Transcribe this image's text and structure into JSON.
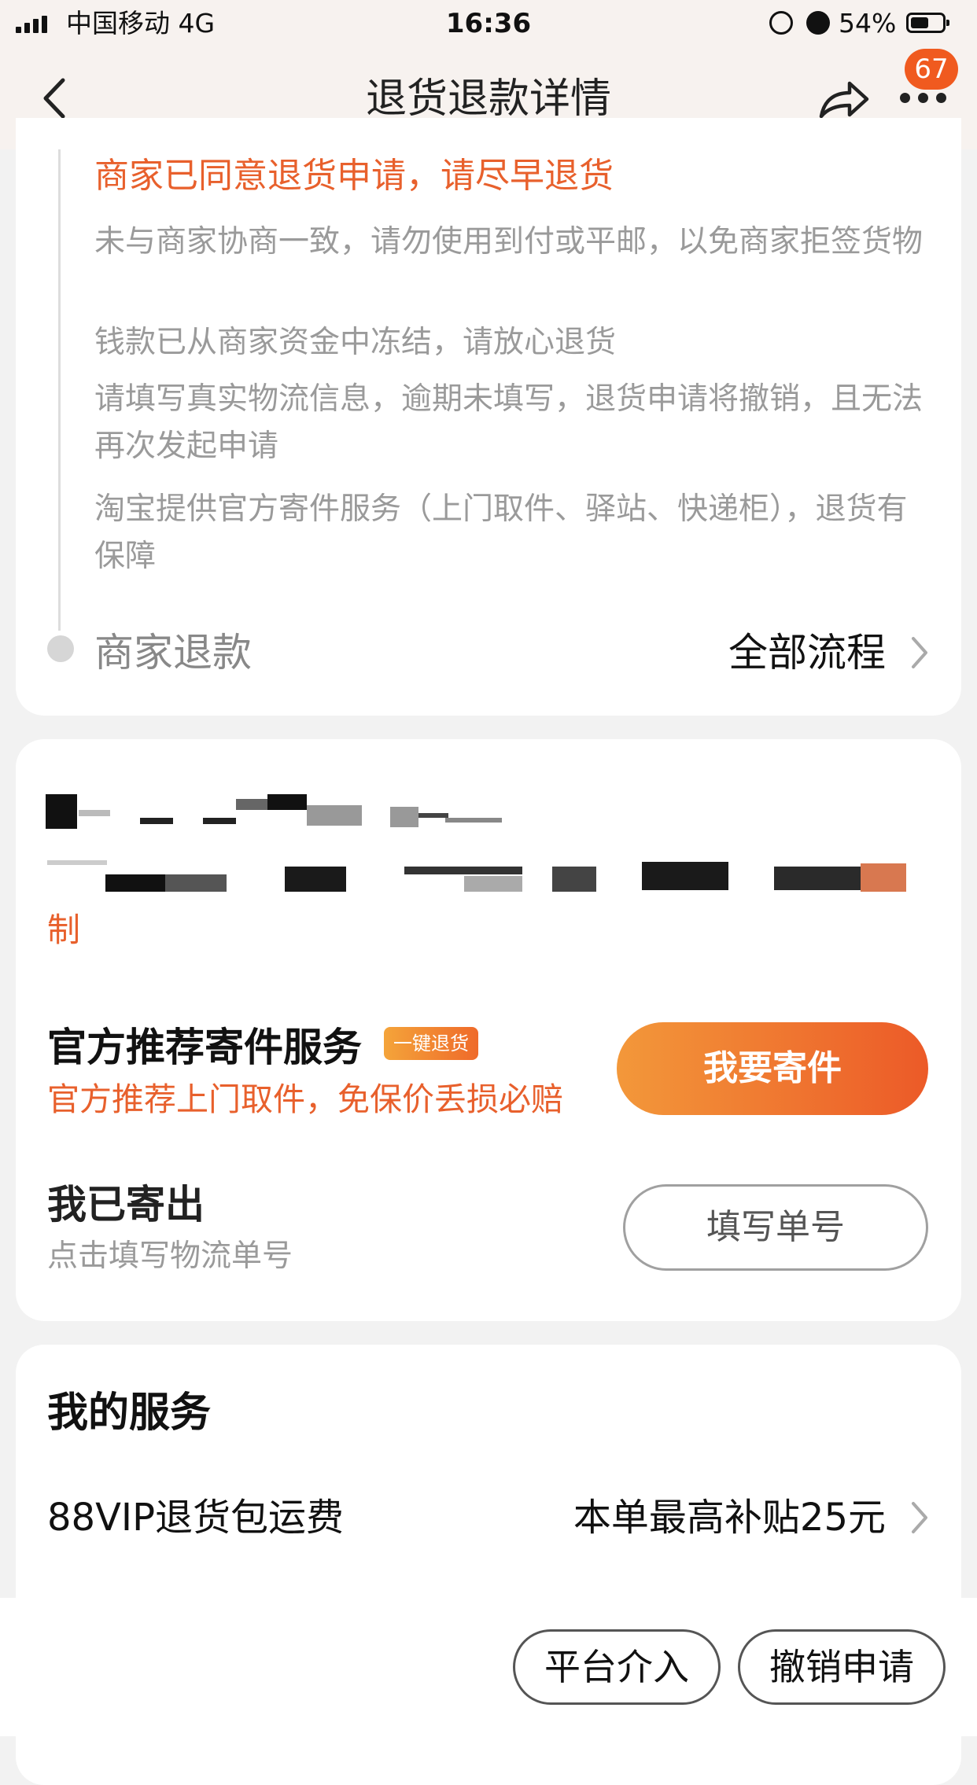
{
  "status_bar": {
    "carrier": "中国移动  4G",
    "time": "16:36",
    "battery": "54%"
  },
  "nav": {
    "title": "退货退款详情",
    "badge_count": "67",
    "icons": [
      "back-arrow-icon",
      "share-icon",
      "more-icon"
    ]
  },
  "progress": {
    "current_step_title": "商家已同意退货申请，请尽早退货",
    "notes": [
      "未与商家协商一致，请勿使用到付或平邮，以免商家拒签货物",
      "钱款已从商家资金中冻结，请放心退货",
      "请填写真实物流信息，逾期未填写，退货申请将撤销，且无法再次发起申请",
      "淘宝提供官方寄件服务（上门取件、驿站、快递柜），退货有保障"
    ],
    "next_step": "商家退款",
    "all_flow_link": "全部流程"
  },
  "return_card": {
    "partial_text": "制",
    "official_service": {
      "title": "官方推荐寄件服务",
      "tag": "一键退货",
      "subtitle": "官方推荐上门取件，免保价丢损必赔",
      "button": "我要寄件"
    },
    "shipped": {
      "title": "我已寄出",
      "subtitle": "点击填写物流单号",
      "button": "填写单号"
    }
  },
  "my_services": {
    "title": "我的服务",
    "row_label": "88VIP退货包运费",
    "row_value": "本单最高补贴25元"
  },
  "bottom_actions": {
    "platform": "平台介入",
    "cancel": "撤销申请"
  },
  "colors": {
    "accent": "#e8602c",
    "button_gradient_start": "#f3983a",
    "button_gradient_end": "#ec5a28",
    "badge": "#f05a1f"
  }
}
